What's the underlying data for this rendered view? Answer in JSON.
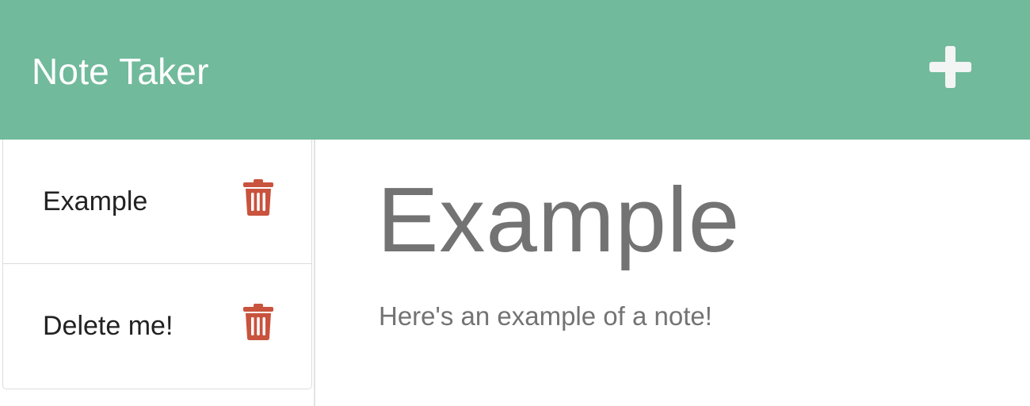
{
  "header": {
    "title": "Note Taker",
    "new_note_icon": "plus-icon",
    "background_color": "#71ba9c"
  },
  "sidebar": {
    "notes": [
      {
        "title": "Example",
        "delete_icon": "trash-icon"
      },
      {
        "title": "Delete me!",
        "delete_icon": "trash-icon"
      }
    ],
    "delete_icon_color": "#c9533d"
  },
  "main": {
    "note_title": "Example",
    "note_text": "Here's an example of a note!"
  }
}
